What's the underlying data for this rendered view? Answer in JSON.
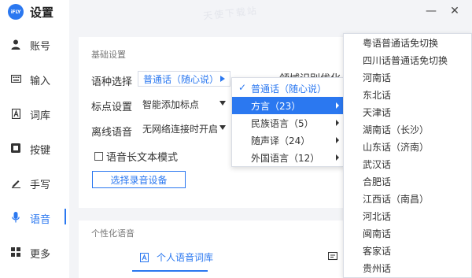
{
  "app": {
    "logo_text": "iFLY",
    "title": "设置",
    "watermark": "天使下载站"
  },
  "window": {
    "minimize": "—",
    "close": "✕"
  },
  "sidebar": {
    "items": [
      {
        "label": "账号",
        "icon": "user-icon"
      },
      {
        "label": "输入",
        "icon": "keyboard-icon"
      },
      {
        "label": "词库",
        "icon": "dictionary-icon"
      },
      {
        "label": "按键",
        "icon": "key-icon"
      },
      {
        "label": "手写",
        "icon": "pen-icon"
      },
      {
        "label": "语音",
        "icon": "microphone-icon"
      },
      {
        "label": "更多",
        "icon": "grid-icon"
      }
    ],
    "active_index": 5
  },
  "basic": {
    "title": "基础设置",
    "language_label": "语种选择",
    "language_value": "普通话（随心说）",
    "domain_label": "领域识别优化",
    "punct_label": "标点设置",
    "punct_value": "智能添加标点",
    "offline_label": "离线语音",
    "offline_value": "无网络连接时开启",
    "long_text_label": "语音长文本模式",
    "record_device_button": "选择录音设备"
  },
  "personal": {
    "title": "个性化语音",
    "tab_label": "个人语音词库"
  },
  "language_menu": {
    "items": [
      {
        "label": "普通话（随心说）",
        "checked": true,
        "submenu": false
      },
      {
        "label": "方言（23）",
        "checked": false,
        "submenu": true
      },
      {
        "label": "民族语言（5）",
        "checked": false,
        "submenu": true
      },
      {
        "label": "随声译（24）",
        "checked": false,
        "submenu": true
      },
      {
        "label": "外国语言（12）",
        "checked": false,
        "submenu": true
      }
    ],
    "hover_index": 1,
    "check_glyph": "✓"
  },
  "dialect_menu": {
    "items": [
      "粤语普通话免切换",
      "四川话普通话免切换",
      "河南话",
      "东北话",
      "天津话",
      "湖南话（长沙）",
      "山东话（济南）",
      "武汉话",
      "合肥话",
      "江西话（南昌）",
      "河北话",
      "闽南话",
      "客家话",
      "贵州话"
    ]
  },
  "colors": {
    "accent": "#2b78f0",
    "background": "#f3f4f7"
  }
}
